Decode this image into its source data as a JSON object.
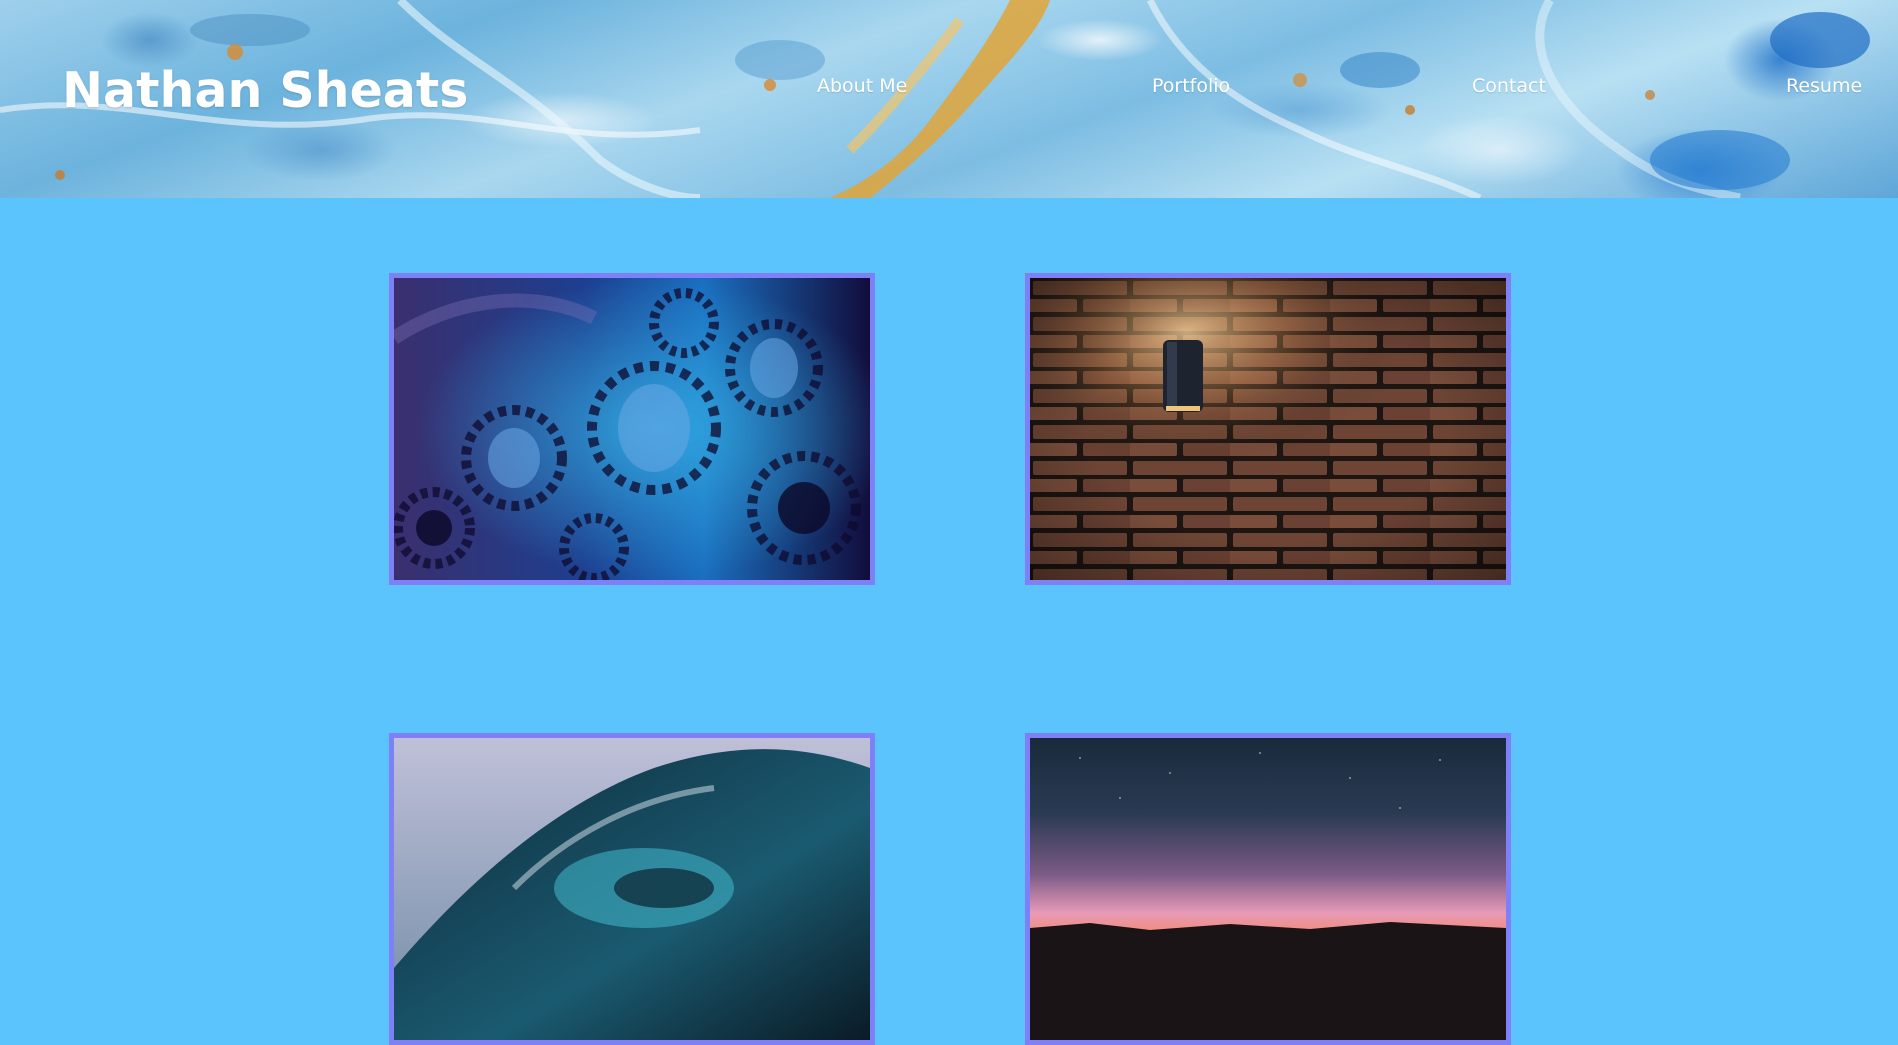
{
  "header": {
    "title": "Nathan Sheats",
    "nav": [
      {
        "label": "About Me"
      },
      {
        "label": "Portfolio"
      },
      {
        "label": "Contact"
      },
      {
        "label": "Resume"
      }
    ]
  },
  "portfolio": {
    "items": [
      {
        "image": "gears-image"
      },
      {
        "image": "brick-wall-lamp-image"
      },
      {
        "image": "ocean-wave-image"
      },
      {
        "image": "sunset-horizon-image"
      }
    ]
  },
  "colors": {
    "page_background": "#5cc4fd",
    "card_border": "#7f7ff7",
    "header_text": "#ffffff"
  }
}
